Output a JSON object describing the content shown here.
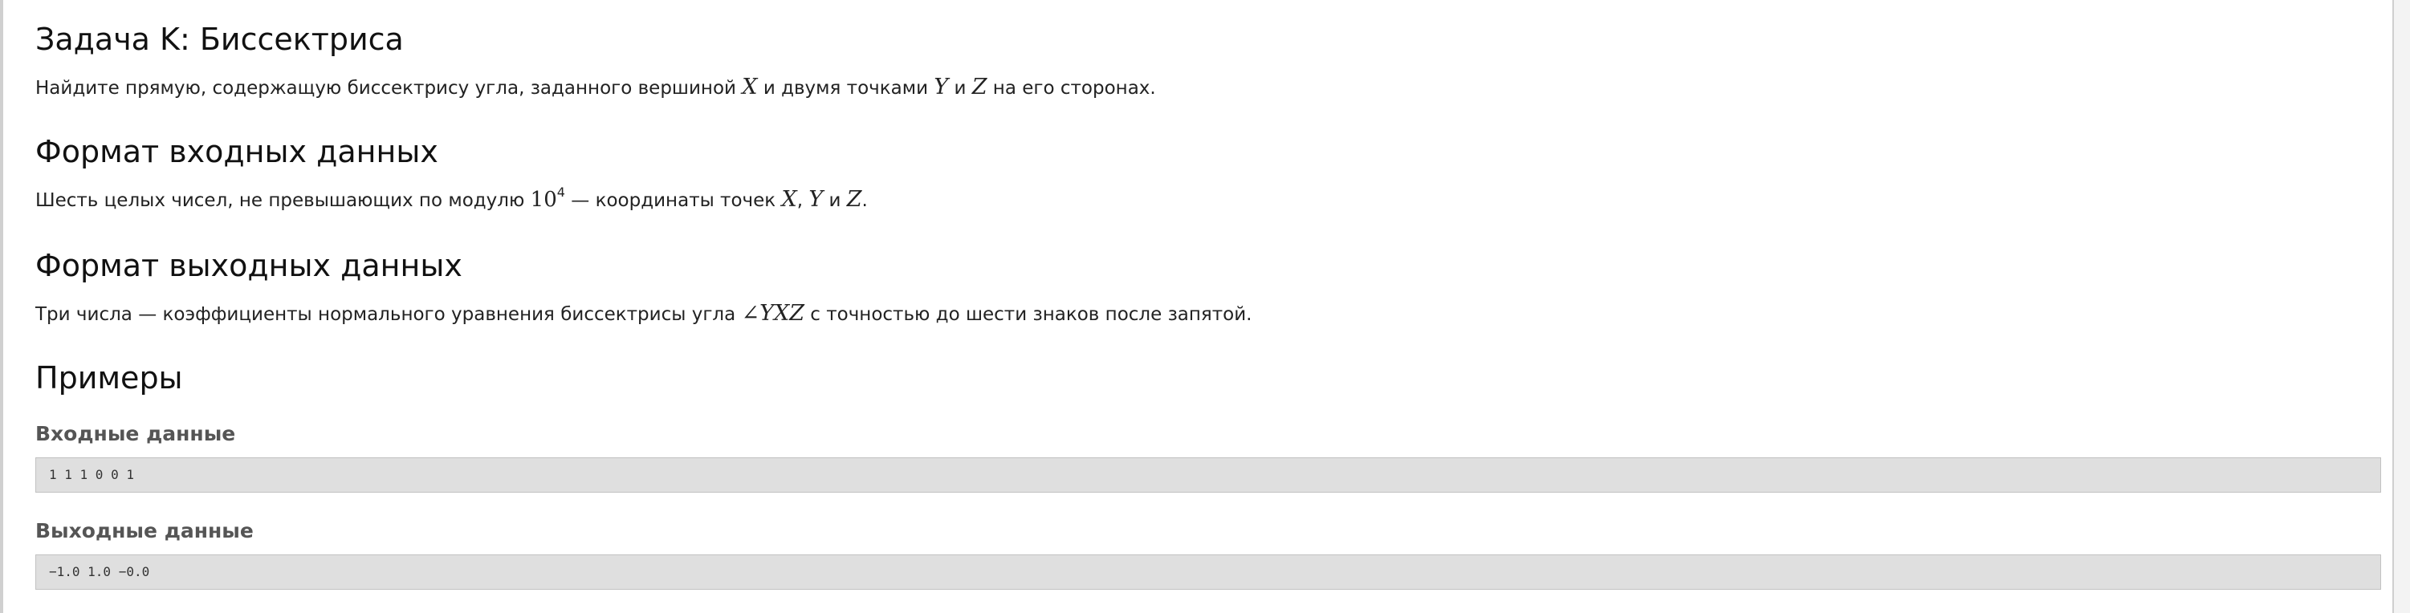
{
  "problem": {
    "title": "Задача K: Биссектриса",
    "statement": {
      "part1": "Найдите прямую, содержащую биссектрису угла, заданного вершиной ",
      "var_x": "X",
      "part2": " и двумя точками ",
      "var_y": "Y",
      "part3": " и ",
      "var_z": "Z",
      "part4": " на его сторонах."
    }
  },
  "input_format": {
    "heading": "Формат входных данных",
    "part1": "Шесть целых чисел, не превышающих по модулю ",
    "base": "10",
    "exponent": "4",
    "part2": " — координаты точек ",
    "var_x": "X",
    "comma": ", ",
    "var_y": "Y",
    "part3": " и ",
    "var_z": "Z",
    "part4": "."
  },
  "output_format": {
    "heading": "Формат выходных данных",
    "part1": "Три числа — коэффициенты нормального уравнения биссектрисы угла ",
    "angle": "∠YXZ",
    "part2": " с точностью до шести знаков после запятой."
  },
  "examples": {
    "heading": "Примеры",
    "input_label": "Входные данные",
    "input_value": "1 1 1 0 0 1",
    "output_label": "Выходные данные",
    "output_value": "−1.0 1.0 −0.0"
  }
}
